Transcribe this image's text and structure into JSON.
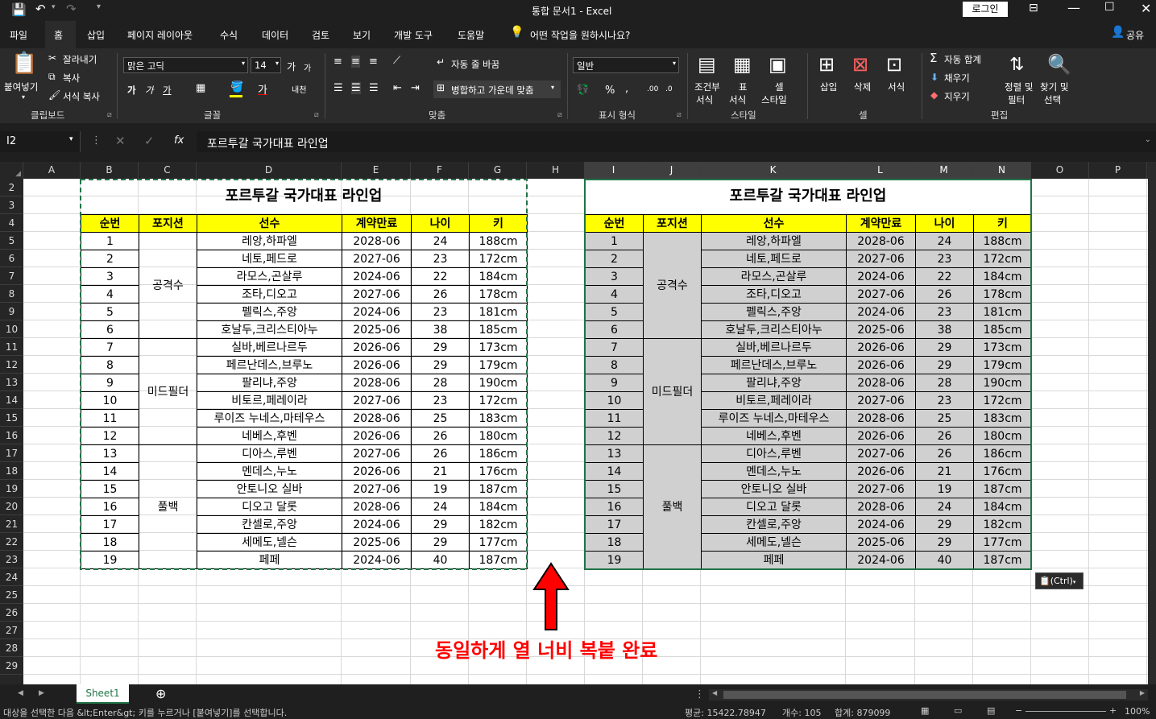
{
  "titlebar": {
    "title": "통합 문서1  -  Excel",
    "login": "로그인"
  },
  "menu": {
    "tabs": [
      "파일",
      "홈",
      "삽입",
      "페이지 레이아웃",
      "수식",
      "데이터",
      "검토",
      "보기",
      "개발 도구",
      "도움말"
    ],
    "tell_me": "어떤 작업을 원하시나요?",
    "share": "공유"
  },
  "ribbon": {
    "clipboard": {
      "paste": "붙여넣기",
      "cut": "잘라내기",
      "copy": "복사",
      "format_painter": "서식 복사",
      "label": "클립보드"
    },
    "font": {
      "name": "맑은 고딕",
      "size": "14",
      "bold": "가",
      "italic": "가",
      "underline": "가",
      "grow": "가",
      "shrink": "가",
      "label": "글꼴"
    },
    "align": {
      "wrap": "자동 줄 바꿈",
      "merge": "병합하고 가운데 맞춤",
      "label": "맞춤"
    },
    "number": {
      "format": "일반",
      "percent": "%",
      "comma": ",",
      "label": "표시 형식"
    },
    "styles": {
      "cond1": "조건부",
      "cond2": "서식",
      "table1": "표",
      "table2": "서식",
      "cell1": "셀",
      "cell2": "스타일",
      "label": "스타일"
    },
    "cells": {
      "insert": "삽입",
      "delete": "삭제",
      "format": "서식",
      "label": "셀"
    },
    "editing": {
      "autosum": "자동 합계",
      "fill": "채우기",
      "clear": "지우기",
      "sort1": "정렬 및",
      "sort2": "필터",
      "find1": "찾기 및",
      "find2": "선택",
      "label": "편집"
    }
  },
  "formula_bar": {
    "name_box": "I2",
    "fx": "fx",
    "content": "포르투갈 국가대표 라인업"
  },
  "columns": [
    "A",
    "B",
    "C",
    "D",
    "E",
    "F",
    "G",
    "H",
    "I",
    "J",
    "K",
    "L",
    "M",
    "N",
    "O",
    "P"
  ],
  "rows": [
    "2",
    "3",
    "4",
    "5",
    "6",
    "7",
    "8",
    "9",
    "10",
    "11",
    "12",
    "13",
    "14",
    "15",
    "16",
    "17",
    "18",
    "19",
    "20",
    "21",
    "22",
    "23",
    "24",
    "25",
    "26",
    "27",
    "28",
    "29"
  ],
  "table": {
    "title": "포르투갈 국가대표 라인업",
    "headers": [
      "순번",
      "포지션",
      "선수",
      "계약만료",
      "나이",
      "키"
    ],
    "positions": [
      "공격수",
      "미드필더",
      "풀백"
    ],
    "rows": [
      [
        "1",
        "레앙,하파엘",
        "2028-06",
        "24",
        "188cm"
      ],
      [
        "2",
        "네토,페드로",
        "2027-06",
        "23",
        "172cm"
      ],
      [
        "3",
        "라모스,곤살루",
        "2024-06",
        "22",
        "184cm"
      ],
      [
        "4",
        "조타,디오고",
        "2027-06",
        "26",
        "178cm"
      ],
      [
        "5",
        "펠릭스,주앙",
        "2024-06",
        "23",
        "181cm"
      ],
      [
        "6",
        "호날두,크리스티아누",
        "2025-06",
        "38",
        "185cm"
      ],
      [
        "7",
        "실바,베르나르두",
        "2026-06",
        "29",
        "173cm"
      ],
      [
        "8",
        "페르난데스,브루노",
        "2026-06",
        "29",
        "179cm"
      ],
      [
        "9",
        "팔리냐,주앙",
        "2028-06",
        "28",
        "190cm"
      ],
      [
        "10",
        "비토르,페레이라",
        "2027-06",
        "23",
        "172cm"
      ],
      [
        "11",
        "루이즈 누네스,마테우스",
        "2028-06",
        "25",
        "183cm"
      ],
      [
        "12",
        "네베스,후벤",
        "2026-06",
        "26",
        "180cm"
      ],
      [
        "13",
        "디아스,루벤",
        "2027-06",
        "26",
        "186cm"
      ],
      [
        "14",
        "멘데스,누노",
        "2026-06",
        "21",
        "176cm"
      ],
      [
        "15",
        "안토니오 실바",
        "2027-06",
        "19",
        "187cm"
      ],
      [
        "16",
        "디오고 달롯",
        "2028-06",
        "24",
        "184cm"
      ],
      [
        "17",
        "칸셀로,주앙",
        "2024-06",
        "29",
        "182cm"
      ],
      [
        "18",
        "세메도,넬슨",
        "2025-06",
        "29",
        "177cm"
      ],
      [
        "19",
        "페페",
        "2024-06",
        "40",
        "187cm"
      ]
    ]
  },
  "paste_options": "(Ctrl)",
  "annotation": {
    "text": "동일하게 열 너비 복붙 완료",
    "color": "#ff0000"
  },
  "sheet_tab": "Sheet1",
  "status": {
    "message": "대상을 선택한 다음 &lt;Enter&gt; 키를 누르거나 [붙여넣기]를 선택합니다.",
    "average": "평균: 15422.78947",
    "count": "개수: 105",
    "sum": "합계: 879099",
    "zoom": "100%"
  },
  "colors": {
    "header_fill": "#ffff00",
    "gray_fill": "#d0d0d0",
    "accent": "#217346"
  }
}
